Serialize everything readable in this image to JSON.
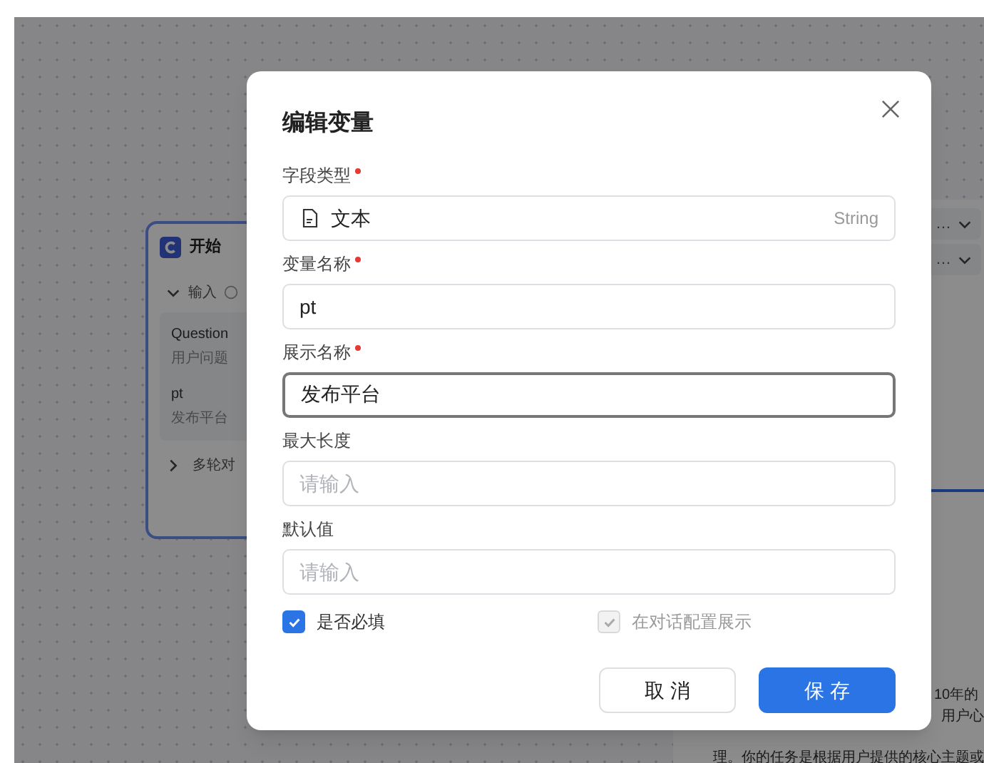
{
  "background": {
    "start_node": {
      "title": "开始",
      "section": "输入",
      "items": [
        {
          "name": "Question",
          "description": "用户问题"
        },
        {
          "name": "pt",
          "description": "发布平台"
        }
      ],
      "collapsed_section": "多轮对"
    },
    "right_panel": {
      "dropdowns": [
        "…",
        "…"
      ],
      "text_lines": [
        "10年的",
        "用户心",
        "理。你的任务是根据用户提供的核心主题或"
      ]
    }
  },
  "dialog": {
    "title": "编辑变量",
    "fields": [
      {
        "label": "字段类型",
        "required": true,
        "kind": "select",
        "value": "文本",
        "hint": "String",
        "focused": false
      },
      {
        "label": "变量名称",
        "required": true,
        "kind": "input",
        "value": "pt",
        "focused": false
      },
      {
        "label": "展示名称",
        "required": true,
        "kind": "input",
        "value": "发布平台",
        "focused": true
      },
      {
        "label": "最大长度",
        "required": false,
        "kind": "input",
        "placeholder": "请输入",
        "focused": false
      },
      {
        "label": "默认值",
        "required": false,
        "kind": "input",
        "placeholder": "请输入",
        "focused": false
      }
    ],
    "checkboxes": [
      {
        "label": "是否必填",
        "checked": true,
        "disabled": false
      },
      {
        "label": "在对话配置展示",
        "checked": true,
        "disabled": true
      }
    ],
    "buttons": [
      {
        "label": "取 消",
        "kind": "secondary"
      },
      {
        "label": "保 存",
        "kind": "primary"
      }
    ]
  }
}
